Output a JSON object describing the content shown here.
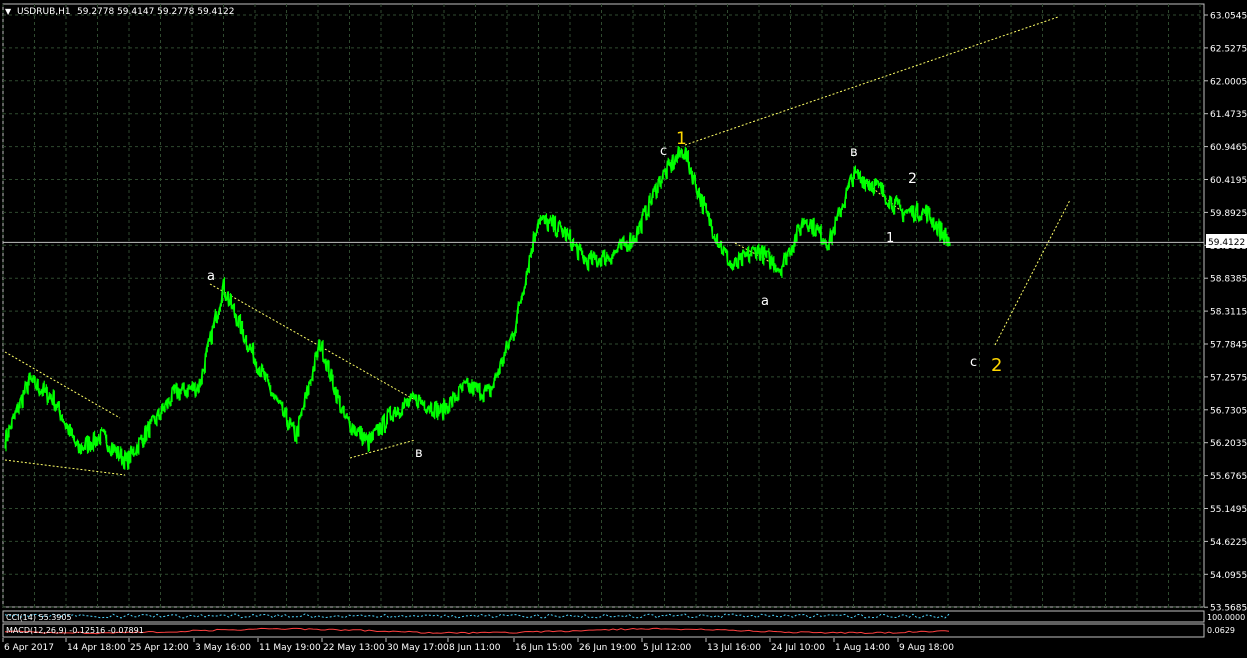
{
  "header": {
    "symbol_label": "USDRUB,H1",
    "ohlc": "59.2778 59.4147 59.2778 59.4122"
  },
  "colors": {
    "background": "#000000",
    "grid": "#2d3f2d",
    "candles": "#00ff00",
    "price_line": "#c0c0c0",
    "axis_text": "#ffffff",
    "wave_major": "#ffd700",
    "wave_minor": "#ffffff",
    "trendline": "#ffff66",
    "macd_line": "#ff4040"
  },
  "y_axis": {
    "ticks": [
      "63.0545",
      "62.5275",
      "62.0005",
      "61.4735",
      "60.9465",
      "60.4195",
      "59.8925",
      "59.3655",
      "58.8385",
      "58.3115",
      "57.7845",
      "57.2575",
      "56.7305",
      "56.2035",
      "55.6765",
      "55.1495",
      "54.6225",
      "54.0955",
      "53.5685"
    ],
    "current_price": "59.4122"
  },
  "x_axis": {
    "labels": [
      "6 Apr 2017",
      "14 Apr 18:00",
      "25 Apr 12:00",
      "3 May 16:00",
      "11 May 19:00",
      "22 May 13:00",
      "30 May 17:00",
      "8 Jun 11:00",
      "16 Jun 15:00",
      "26 Jun 19:00",
      "5 Jul 12:00",
      "13 Jul 16:00",
      "24 Jul 10:00",
      "1 Aug 14:00",
      "9 Aug 18:00"
    ]
  },
  "wave_labels": {
    "major_1": "1",
    "major_2": "2",
    "a_left": "a",
    "b_left": "в",
    "c_top": "c",
    "a_mid": "a",
    "b_mid": "в",
    "minor_1": "1",
    "minor_2": "2",
    "c_future": "c"
  },
  "indicators": {
    "cci_label": "CCI(14) 55.3905",
    "macd_label": "MACD(12,26,9) -0.12516 -0.07891",
    "cci_right": "100.0000",
    "macd_right": "0.0629"
  },
  "chart_data": {
    "type": "line",
    "title": "USDRUB,H1",
    "xlabel": "",
    "ylabel": "",
    "ylim": [
      53.5685,
      63.0545
    ],
    "categories": [
      "6 Apr 2017",
      "14 Apr 18:00",
      "25 Apr 12:00",
      "3 May 16:00",
      "11 May 19:00",
      "22 May 13:00",
      "30 May 17:00",
      "8 Jun 11:00",
      "16 Jun 15:00",
      "26 Jun 19:00",
      "5 Jul 12:00",
      "13 Jul 16:00",
      "24 Jul 10:00",
      "1 Aug 14:00",
      "9 Aug 18:00"
    ],
    "series": [
      {
        "name": "USDRUB",
        "values": [
          56.25,
          57.2,
          56.9,
          56.1,
          56.3,
          55.9,
          56.45,
          57.0,
          57.1,
          58.7,
          57.8,
          57.0,
          56.3,
          57.8,
          56.6,
          56.2,
          56.7,
          56.9,
          56.7,
          57.1,
          57.0,
          58.0,
          59.8,
          59.6,
          59.1,
          59.2,
          59.5,
          60.4,
          60.9,
          59.8,
          59.0,
          59.3,
          59.0,
          59.8,
          59.4,
          60.5,
          60.3,
          59.9,
          59.9,
          59.4
        ]
      }
    ],
    "annotations": [
      "1",
      "2",
      "a",
      "в",
      "c",
      "a",
      "в",
      "1",
      "2",
      "c"
    ]
  }
}
